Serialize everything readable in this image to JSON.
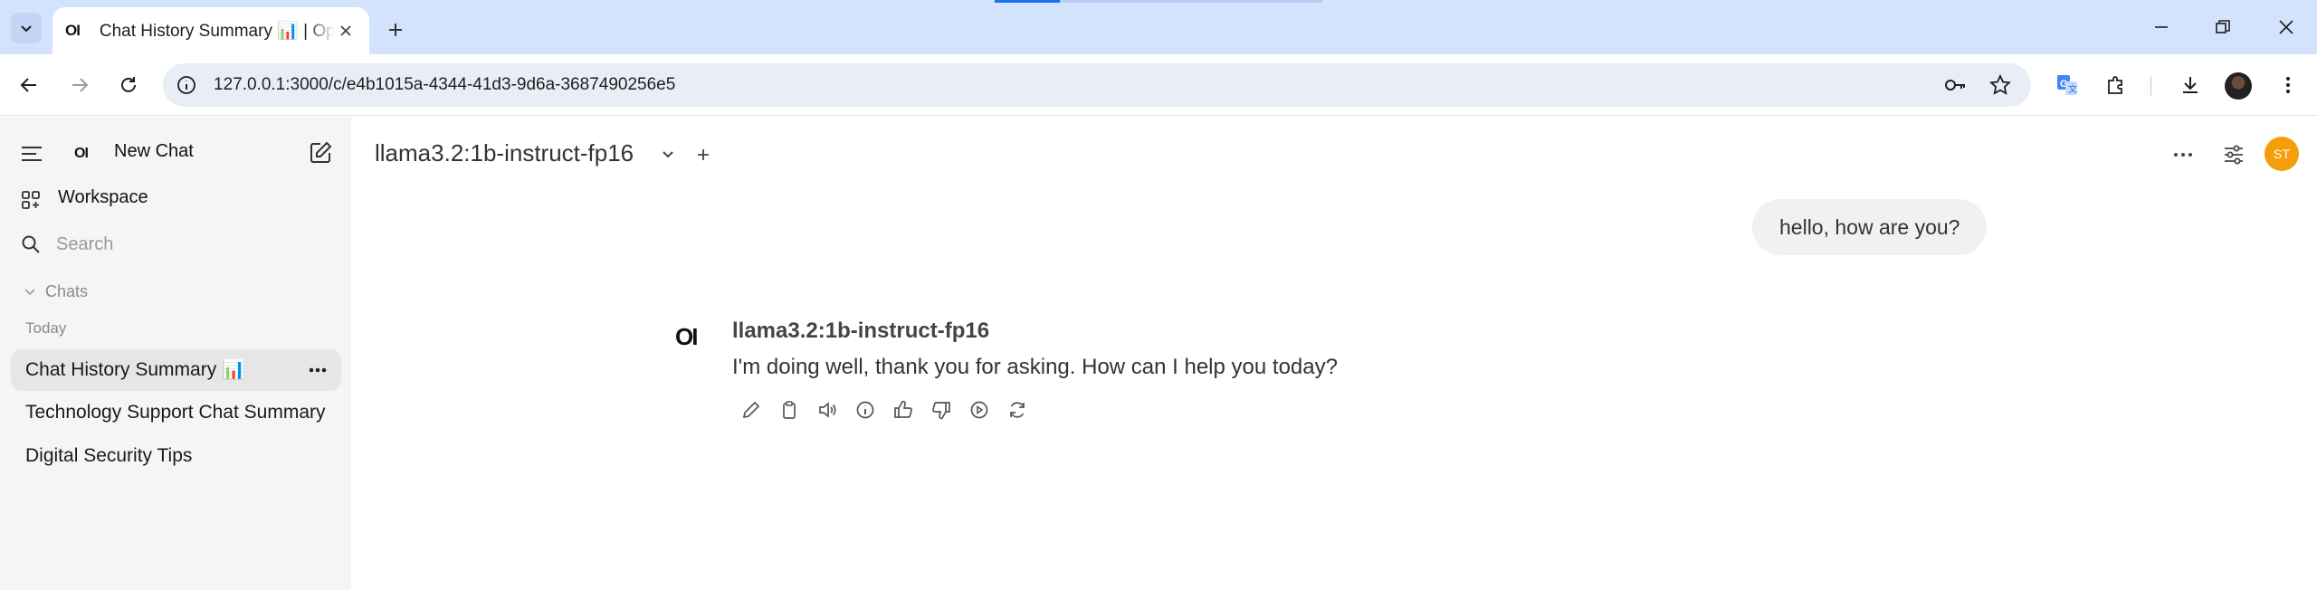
{
  "browser": {
    "tab": {
      "favicon_text": "OI",
      "title": "Chat History Summary 📊 | Open WebUI"
    },
    "address_bar": {
      "url": "127.0.0.1:3000/c/e4b1015a-4344-41d3-9d6a-3687490256e5"
    },
    "icons": [
      "tab-search-icon",
      "close-tab-icon",
      "new-tab-icon",
      "minimize-icon",
      "restore-icon",
      "close-window-icon",
      "back-icon",
      "forward-icon",
      "reload-icon",
      "site-info-icon",
      "password-key-icon",
      "bookmark-star-icon",
      "translate-icon",
      "extensions-icon",
      "downloads-icon",
      "chrome-menu-icon"
    ]
  },
  "sidebar": {
    "logo_text": "OI",
    "new_chat_label": "New Chat",
    "workspace_label": "Workspace",
    "search_placeholder": "Search",
    "chats_section_label": "Chats",
    "today_label": "Today",
    "chats": [
      {
        "title": "Chat History Summary 📊",
        "active": true
      },
      {
        "title": "Technology Support Chat Summary",
        "active": false
      },
      {
        "title": "Digital Security Tips",
        "active": false
      }
    ]
  },
  "header": {
    "model_name": "llama3.2:1b-instruct-fp16",
    "avatar_initials": "ST",
    "avatar_color": "#f59e0b"
  },
  "conversation": {
    "user_message": "hello, how are you?",
    "assistant": {
      "logo_text": "OI",
      "model_name": "llama3.2:1b-instruct-fp16",
      "message": "I'm doing well, thank you for asking. How can I help you today?"
    },
    "actions": [
      "edit-icon",
      "copy-icon",
      "read-aloud-icon",
      "info-icon",
      "thumbs-up-icon",
      "thumbs-down-icon",
      "continue-icon",
      "regenerate-icon"
    ]
  }
}
